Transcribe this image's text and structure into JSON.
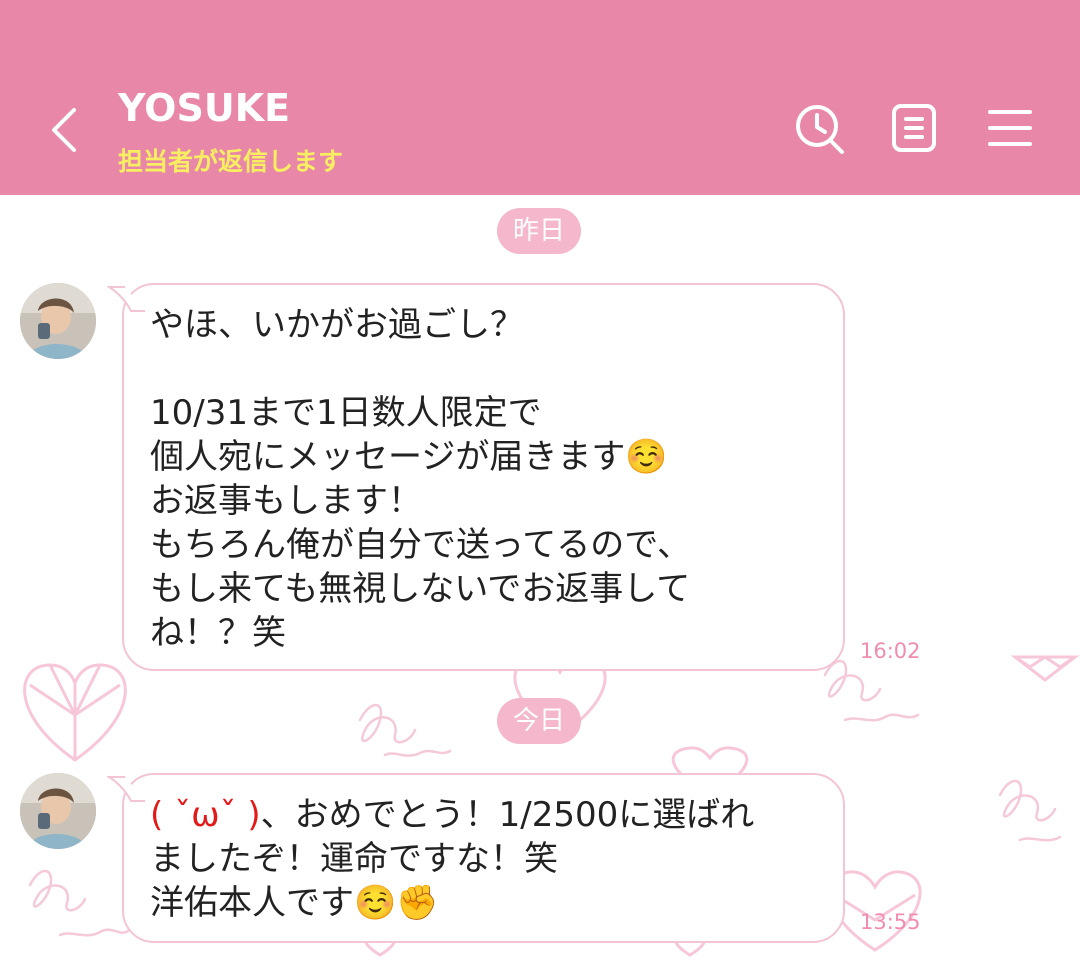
{
  "header": {
    "title": "YOSUKE",
    "subtitle": "担当者が返信します",
    "background_color": "#e887a7",
    "subtitle_color": "#f7ee62",
    "icons": [
      "back-arrow-icon",
      "search-history-icon",
      "notes-icon",
      "menu-icon"
    ]
  },
  "chat": {
    "date_dividers": [
      "昨日",
      "今日"
    ],
    "messages": [
      {
        "sender": "YOSUKE",
        "text": "やほ、いかがお過ごし？\n\n10/31まで1日数人限定で\n個人宛にメッセージが届きます☺️\nお返事もします！\nもちろん俺が自分で送ってるので、\nもし来ても無視しないでお返事して\nね！？笑",
        "time": "16:02"
      },
      {
        "sender": "YOSUKE",
        "kaomoji": "( ˇωˇ )",
        "text_after_kaomoji": "、おめでとう！1/2500に選ばれ\nましたぞ！運命ですな！笑\n洋佑本人です☺️✊",
        "time": "13:55"
      }
    ]
  },
  "colors": {
    "accent": "#e887a7",
    "date_pill": "#f4b7cb",
    "bubble_border": "#f2c4d4",
    "time_text": "#f08cb0",
    "kaomoji": "#e11a1a"
  }
}
